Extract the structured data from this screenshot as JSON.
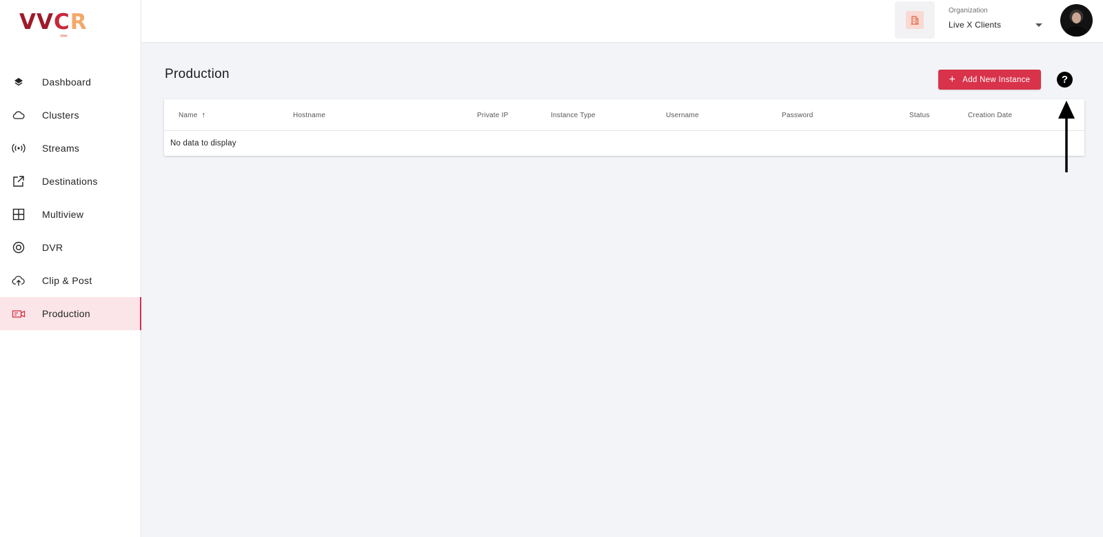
{
  "brand": {
    "logo_part1": "VV",
    "logo_part2": "C",
    "logo_part3": "R",
    "logo_arrows": "››››››"
  },
  "sidebar": {
    "items": [
      {
        "label": "Dashboard",
        "icon": "layers-icon"
      },
      {
        "label": "Clusters",
        "icon": "cloud-icon"
      },
      {
        "label": "Streams",
        "icon": "broadcast-icon"
      },
      {
        "label": "Destinations",
        "icon": "external-link-icon"
      },
      {
        "label": "Multiview",
        "icon": "grid-icon"
      },
      {
        "label": "DVR",
        "icon": "record-icon"
      },
      {
        "label": "Clip & Post",
        "icon": "cloud-upload-icon"
      },
      {
        "label": "Production",
        "icon": "video-camera-icon",
        "active": true
      }
    ]
  },
  "topbar": {
    "org_caption": "Organization",
    "org_value": "Live X Clients",
    "org_icon": "building-icon",
    "avatar_icon": "user-avatar"
  },
  "main": {
    "title": "Production",
    "add_button_label": "Add New Instance",
    "add_button_icon": "plus-icon",
    "help_icon_glyph": "?",
    "table": {
      "columns": [
        "Name",
        "Hostname",
        "Private IP",
        "Instance Type",
        "Username",
        "Password",
        "Status",
        "Creation Date"
      ],
      "sorted_column": "Name",
      "sort_direction": "ascending",
      "empty_message": "No data to display"
    }
  },
  "colors": {
    "accent": "#d8334a",
    "active_bg": "#fbe5e8",
    "page_bg": "#f3f4f8"
  }
}
